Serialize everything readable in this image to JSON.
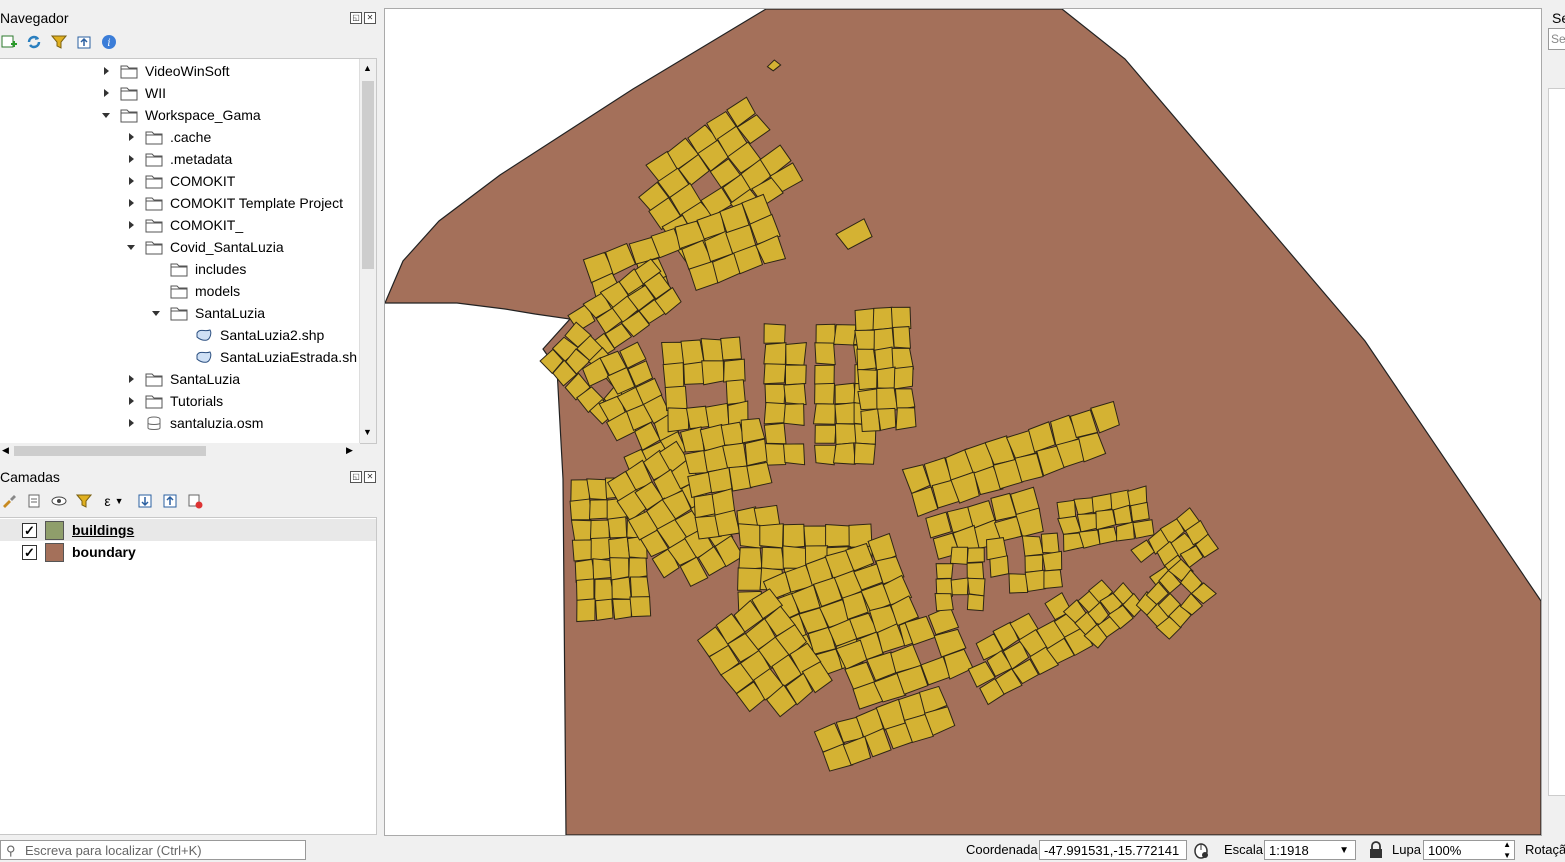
{
  "navigator": {
    "title": "Navegador",
    "toolbar_icons": [
      "add-layer-icon",
      "refresh-icon",
      "filter-icon",
      "collapse-icon",
      "info-icon"
    ],
    "tree": [
      {
        "label": "VideoWinSoft",
        "level": 0,
        "expanded": false,
        "kind": "folder"
      },
      {
        "label": "WII",
        "level": 0,
        "expanded": false,
        "kind": "folder"
      },
      {
        "label": "Workspace_Gama",
        "level": 0,
        "expanded": true,
        "kind": "folder"
      },
      {
        "label": ".cache",
        "level": 1,
        "expanded": false,
        "kind": "folder"
      },
      {
        "label": ".metadata",
        "level": 1,
        "expanded": false,
        "kind": "folder"
      },
      {
        "label": "COMOKIT",
        "level": 1,
        "expanded": false,
        "kind": "folder"
      },
      {
        "label": "COMOKIT Template Project",
        "level": 1,
        "expanded": false,
        "kind": "folder"
      },
      {
        "label": "COMOKIT_",
        "level": 1,
        "expanded": false,
        "kind": "folder"
      },
      {
        "label": "Covid_SantaLuzia",
        "level": 1,
        "expanded": true,
        "kind": "folder"
      },
      {
        "label": "includes",
        "level": 2,
        "expanded": null,
        "kind": "folder"
      },
      {
        "label": "models",
        "level": 2,
        "expanded": null,
        "kind": "folder"
      },
      {
        "label": "SantaLuzia",
        "level": 2,
        "expanded": true,
        "kind": "folder"
      },
      {
        "label": "SantaLuzia2.shp",
        "level": 3,
        "expanded": null,
        "kind": "shape"
      },
      {
        "label": "SantaLuziaEstrada.sh",
        "level": 3,
        "expanded": null,
        "kind": "shape"
      },
      {
        "label": "SantaLuzia",
        "level": 1,
        "expanded": false,
        "kind": "folder"
      },
      {
        "label": "Tutorials",
        "level": 1,
        "expanded": false,
        "kind": "folder"
      },
      {
        "label": "santaluzia.osm",
        "level": 1,
        "expanded": false,
        "kind": "db"
      }
    ]
  },
  "layers": {
    "title": "Camadas",
    "items": [
      {
        "name": "buildings",
        "checked": true,
        "color": "#8f9e6b",
        "selected": true
      },
      {
        "name": "boundary",
        "checked": true,
        "color": "#a4705a",
        "selected": false
      }
    ]
  },
  "map": {
    "boundary_color": "#a4705a",
    "building_color": "#d4b233"
  },
  "right_panel": {
    "title_fragment": "Se",
    "input_fragment": "Se"
  },
  "statusbar": {
    "locate_placeholder": "Escreva para localizar (Ctrl+K)",
    "coord_label": "Coordenada",
    "coord_value": "-47.991531,-15.772141",
    "scale_label": "Escala",
    "scale_value": "1:1918",
    "magnifier_label": "Lupa",
    "magnifier_value": "100%",
    "rotation_label": "Rotaçã"
  }
}
